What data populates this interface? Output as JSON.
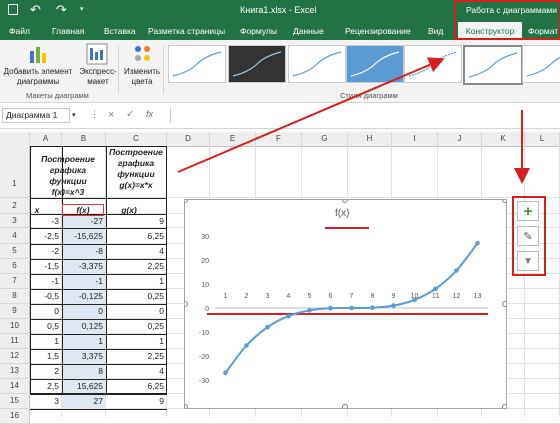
{
  "window": {
    "title": "Книга1.xlsx - Excel",
    "context_tab": "Работа с диаграммами"
  },
  "tabs": [
    "Файл",
    "Главная",
    "Вставка",
    "Разметка страницы",
    "Формулы",
    "Данные",
    "Рецензирование",
    "Вид",
    "Конструктор",
    "Формат"
  ],
  "ribbon": {
    "add_element": "Добавить элемент диаграммы",
    "express_layout": "Экспресс-макет",
    "change_colors": "Изменить цвета",
    "group_layouts": "Макеты диаграмм",
    "group_styles": "Стили диаграмм"
  },
  "name_box": "Диаграмма 1",
  "formula_icons": {
    "cancel": "×",
    "enter": "✓",
    "fx": "fx"
  },
  "columns": [
    "A",
    "B",
    "C",
    "D",
    "E",
    "F",
    "G",
    "H",
    "I",
    "J",
    "K",
    "L"
  ],
  "rows": [
    "1",
    "2",
    "3",
    "4",
    "5",
    "6",
    "7",
    "8",
    "9",
    "10",
    "11",
    "12",
    "13",
    "14",
    "15",
    "16"
  ],
  "sheet": {
    "a1": "Построение графика функции f(x)=x^3",
    "c1": "Построение графика функции g(x)=x*x",
    "a2": "x",
    "b2": "f(x)",
    "c2": "g(x)",
    "x": [
      "-3",
      "-2,5",
      "-2",
      "-1,5",
      "-1",
      "-0,5",
      "0",
      "0,5",
      "1",
      "1,5",
      "2",
      "2,5",
      "3"
    ],
    "fx": [
      "-27",
      "-15,625",
      "-8",
      "-3,375",
      "-1",
      "-0,125",
      "0",
      "0,125",
      "1",
      "3,375",
      "8",
      "15,625",
      "27"
    ],
    "gx": [
      "9",
      "6,25",
      "4",
      "2,25",
      "1",
      "0,25",
      "0",
      "0,25",
      "1",
      "2,25",
      "4",
      "6,25",
      "9"
    ]
  },
  "chart_data": {
    "type": "line",
    "title": "f(x)",
    "categories": [
      "1",
      "2",
      "3",
      "4",
      "5",
      "6",
      "7",
      "8",
      "9",
      "10",
      "11",
      "12",
      "13"
    ],
    "series": [
      {
        "name": "f(x)",
        "values": [
          -27,
          -15.625,
          -8,
          -3.375,
          -1,
          -0.125,
          0,
          0.125,
          1,
          3.375,
          8,
          15.625,
          27
        ]
      }
    ],
    "ylim": [
      -30,
      30
    ],
    "yticks": [
      "30",
      "20",
      "10",
      "0",
      "-10",
      "-20",
      "-30"
    ],
    "grid": false,
    "line_color": "#5b9bd5"
  },
  "chart_tools": {
    "add": "+",
    "style": "✎",
    "filter": "▼"
  },
  "colors": {
    "excel_green": "#217346",
    "annotation_red": "#d61f1f"
  }
}
